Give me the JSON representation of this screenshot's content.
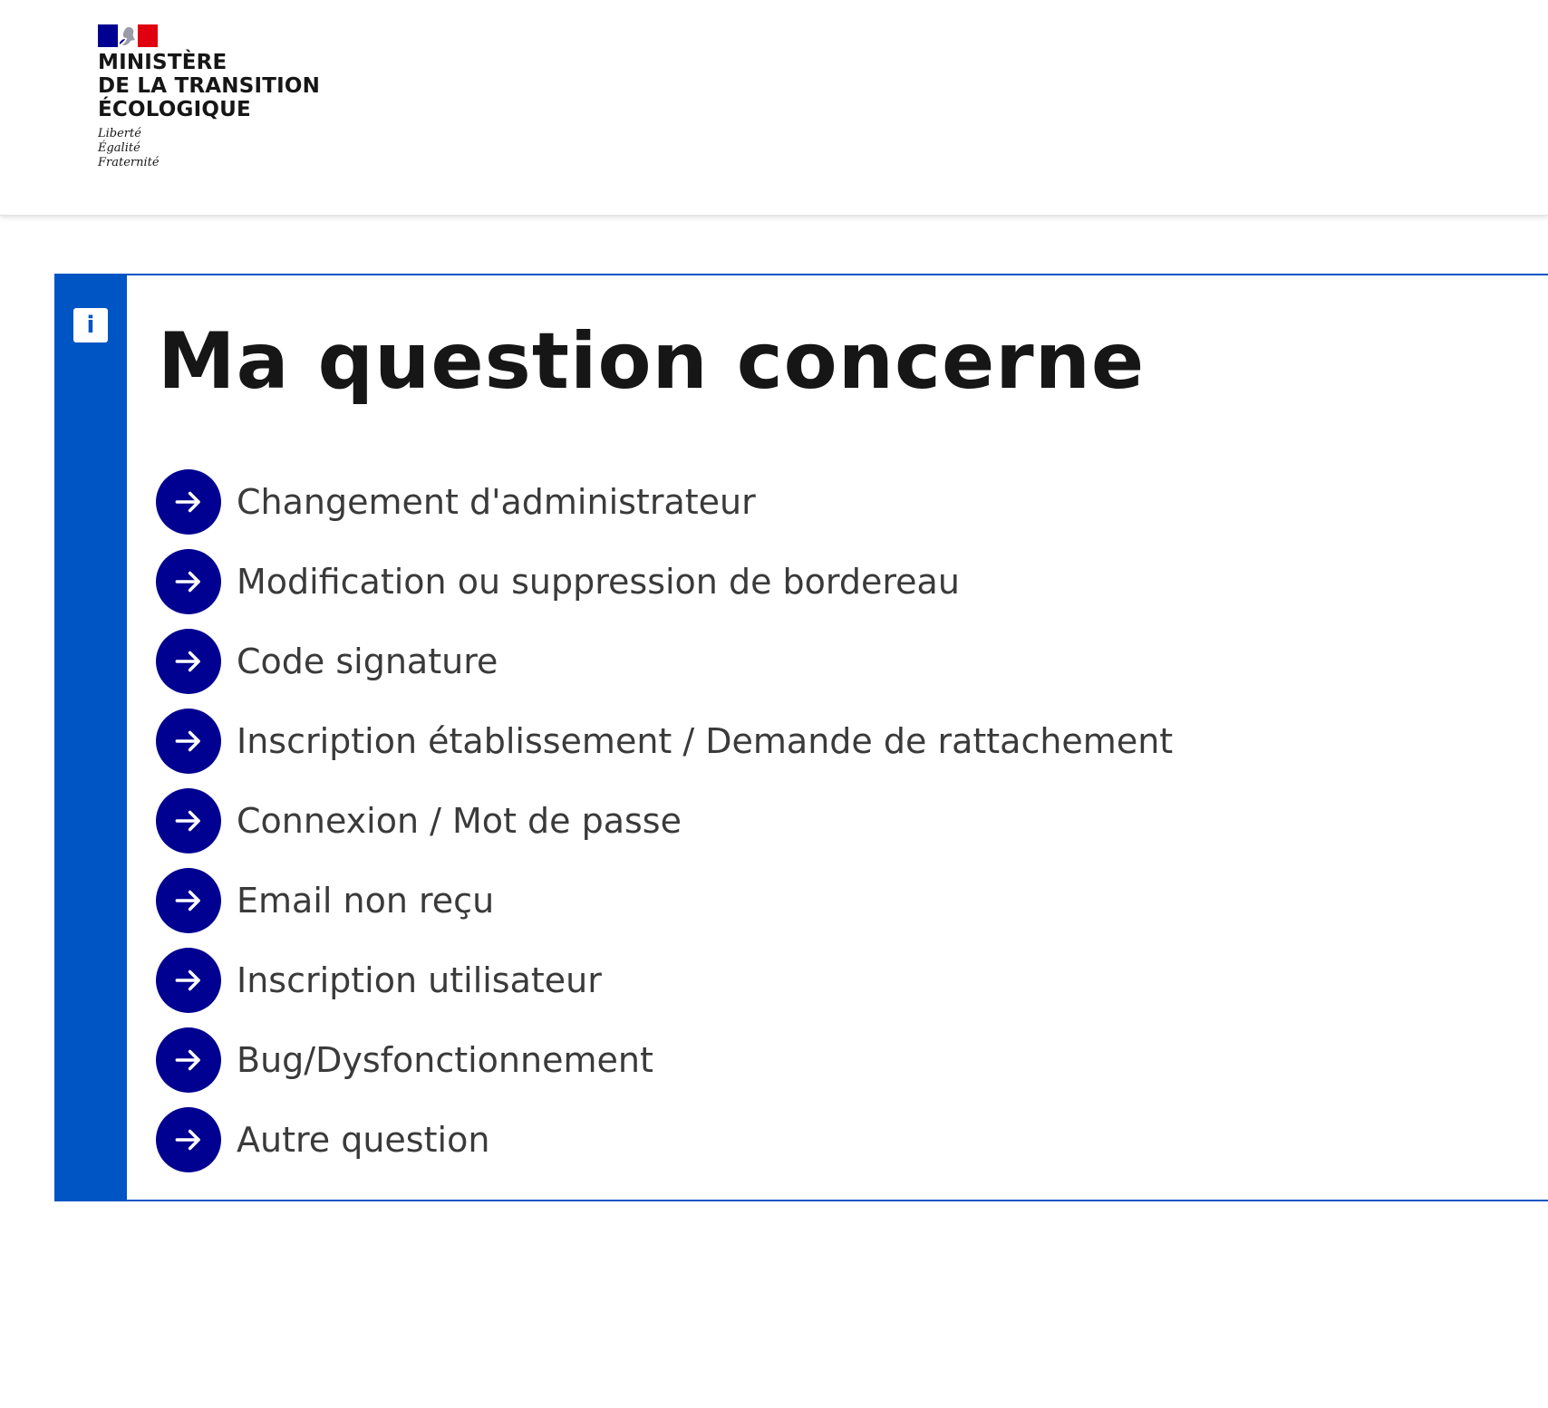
{
  "header": {
    "ministry_lines": [
      "MINISTÈRE",
      "DE LA TRANSITION",
      "ÉCOLOGIQUE"
    ],
    "motto_lines": [
      "Liberté",
      "Égalité",
      "Fraternité"
    ]
  },
  "callout": {
    "icon": "info-icon",
    "icon_glyph": "i",
    "title": "Ma question concerne",
    "items": [
      {
        "label": "Changement d'administrateur"
      },
      {
        "label": "Modification ou suppression de bordereau"
      },
      {
        "label": "Code signature"
      },
      {
        "label": "Inscription établissement / Demande de rattachement"
      },
      {
        "label": "Connexion / Mot de passe"
      },
      {
        "label": "Email non reçu"
      },
      {
        "label": "Inscription utilisateur"
      },
      {
        "label": "Bug/Dysfonctionnement"
      },
      {
        "label": "Autre question"
      }
    ]
  },
  "colors": {
    "accent_blue": "#0055c4",
    "arrow_circle": "#000091",
    "flag_blue": "#000091",
    "flag_red": "#e1000f",
    "text": "#161616"
  }
}
